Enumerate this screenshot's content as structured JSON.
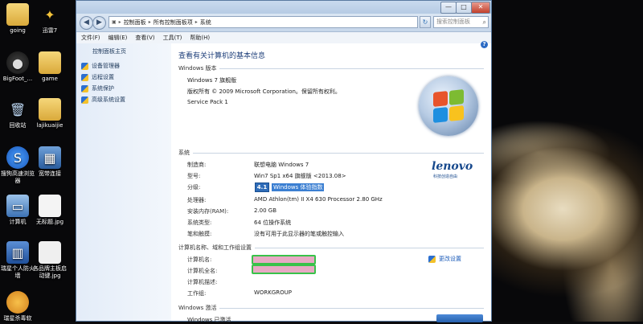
{
  "desktop": {
    "icons": [
      {
        "label": "going"
      },
      {
        "label": "迅雷7"
      },
      {
        "label": "BigFoot_..."
      },
      {
        "label": "game"
      },
      {
        "label": "回收站"
      },
      {
        "label": "lajikuaijie"
      },
      {
        "label": "搜狗高速浏览器"
      },
      {
        "label": "宽带连接"
      },
      {
        "label": "计算机"
      },
      {
        "label": "无标题.jpg"
      },
      {
        "label": "瑞星个人防火墙"
      },
      {
        "label": "各品牌主板启动键.jpg"
      },
      {
        "label": "瑞星杀毒软"
      }
    ]
  },
  "window": {
    "controls": {
      "minimize": "—",
      "maximize": "□",
      "close": "✕"
    },
    "nav": {
      "back": "◀",
      "forward": "▶"
    },
    "address": {
      "crumbs": [
        "控制面板",
        "所有控制面板项",
        "系统"
      ]
    },
    "refresh": "↻",
    "search": {
      "placeholder": "搜索控制面板"
    },
    "menu": [
      "文件(F)",
      "编辑(E)",
      "查看(V)",
      "工具(T)",
      "帮助(H)"
    ],
    "sidebar": {
      "home": "控制面板主页",
      "links": [
        "设备管理器",
        "远程设置",
        "系统保护",
        "高级系统设置"
      ]
    },
    "help": "?",
    "main": {
      "title": "查看有关计算机的基本信息",
      "edition_header": "Windows 版本",
      "edition": "Windows 7 旗舰版",
      "copyright": "版权所有 © 2009 Microsoft Corporation。保留所有权利。",
      "service_pack": "Service Pack 1",
      "system_header": "系统",
      "oem_logo": "lenovo",
      "oem_logo_sub": "科技创造自由",
      "system_rows": [
        {
          "label": "制造商:",
          "value": "联想电脑 Windows 7"
        },
        {
          "label": "型号:",
          "value": "Win7 Sp1 x64 旗舰版 <2013.08>"
        },
        {
          "label": "分级:",
          "value": ""
        },
        {
          "label": "处理器:",
          "value": "AMD Athlon(tm) II X4 630 Processor   2.80 GHz"
        },
        {
          "label": "安装内存(RAM):",
          "value": "2.00 GB"
        },
        {
          "label": "系统类型:",
          "value": "64 位操作系统"
        },
        {
          "label": "笔和触摸:",
          "value": "没有可用于此显示器的笔或触控输入"
        }
      ],
      "rating": {
        "score": "4.1",
        "link": "Windows 体验指数"
      },
      "computer_header": "计算机名称、域和工作组设置",
      "computer_rows": [
        {
          "label": "计算机名:"
        },
        {
          "label": "计算机全名:"
        },
        {
          "label": "计算机描述:"
        },
        {
          "label": "工作组:",
          "value": "WORKGROUP"
        }
      ],
      "change_settings": "更改设置",
      "activation_header": "Windows 激活",
      "activation_status": "Windows 已激活"
    }
  }
}
